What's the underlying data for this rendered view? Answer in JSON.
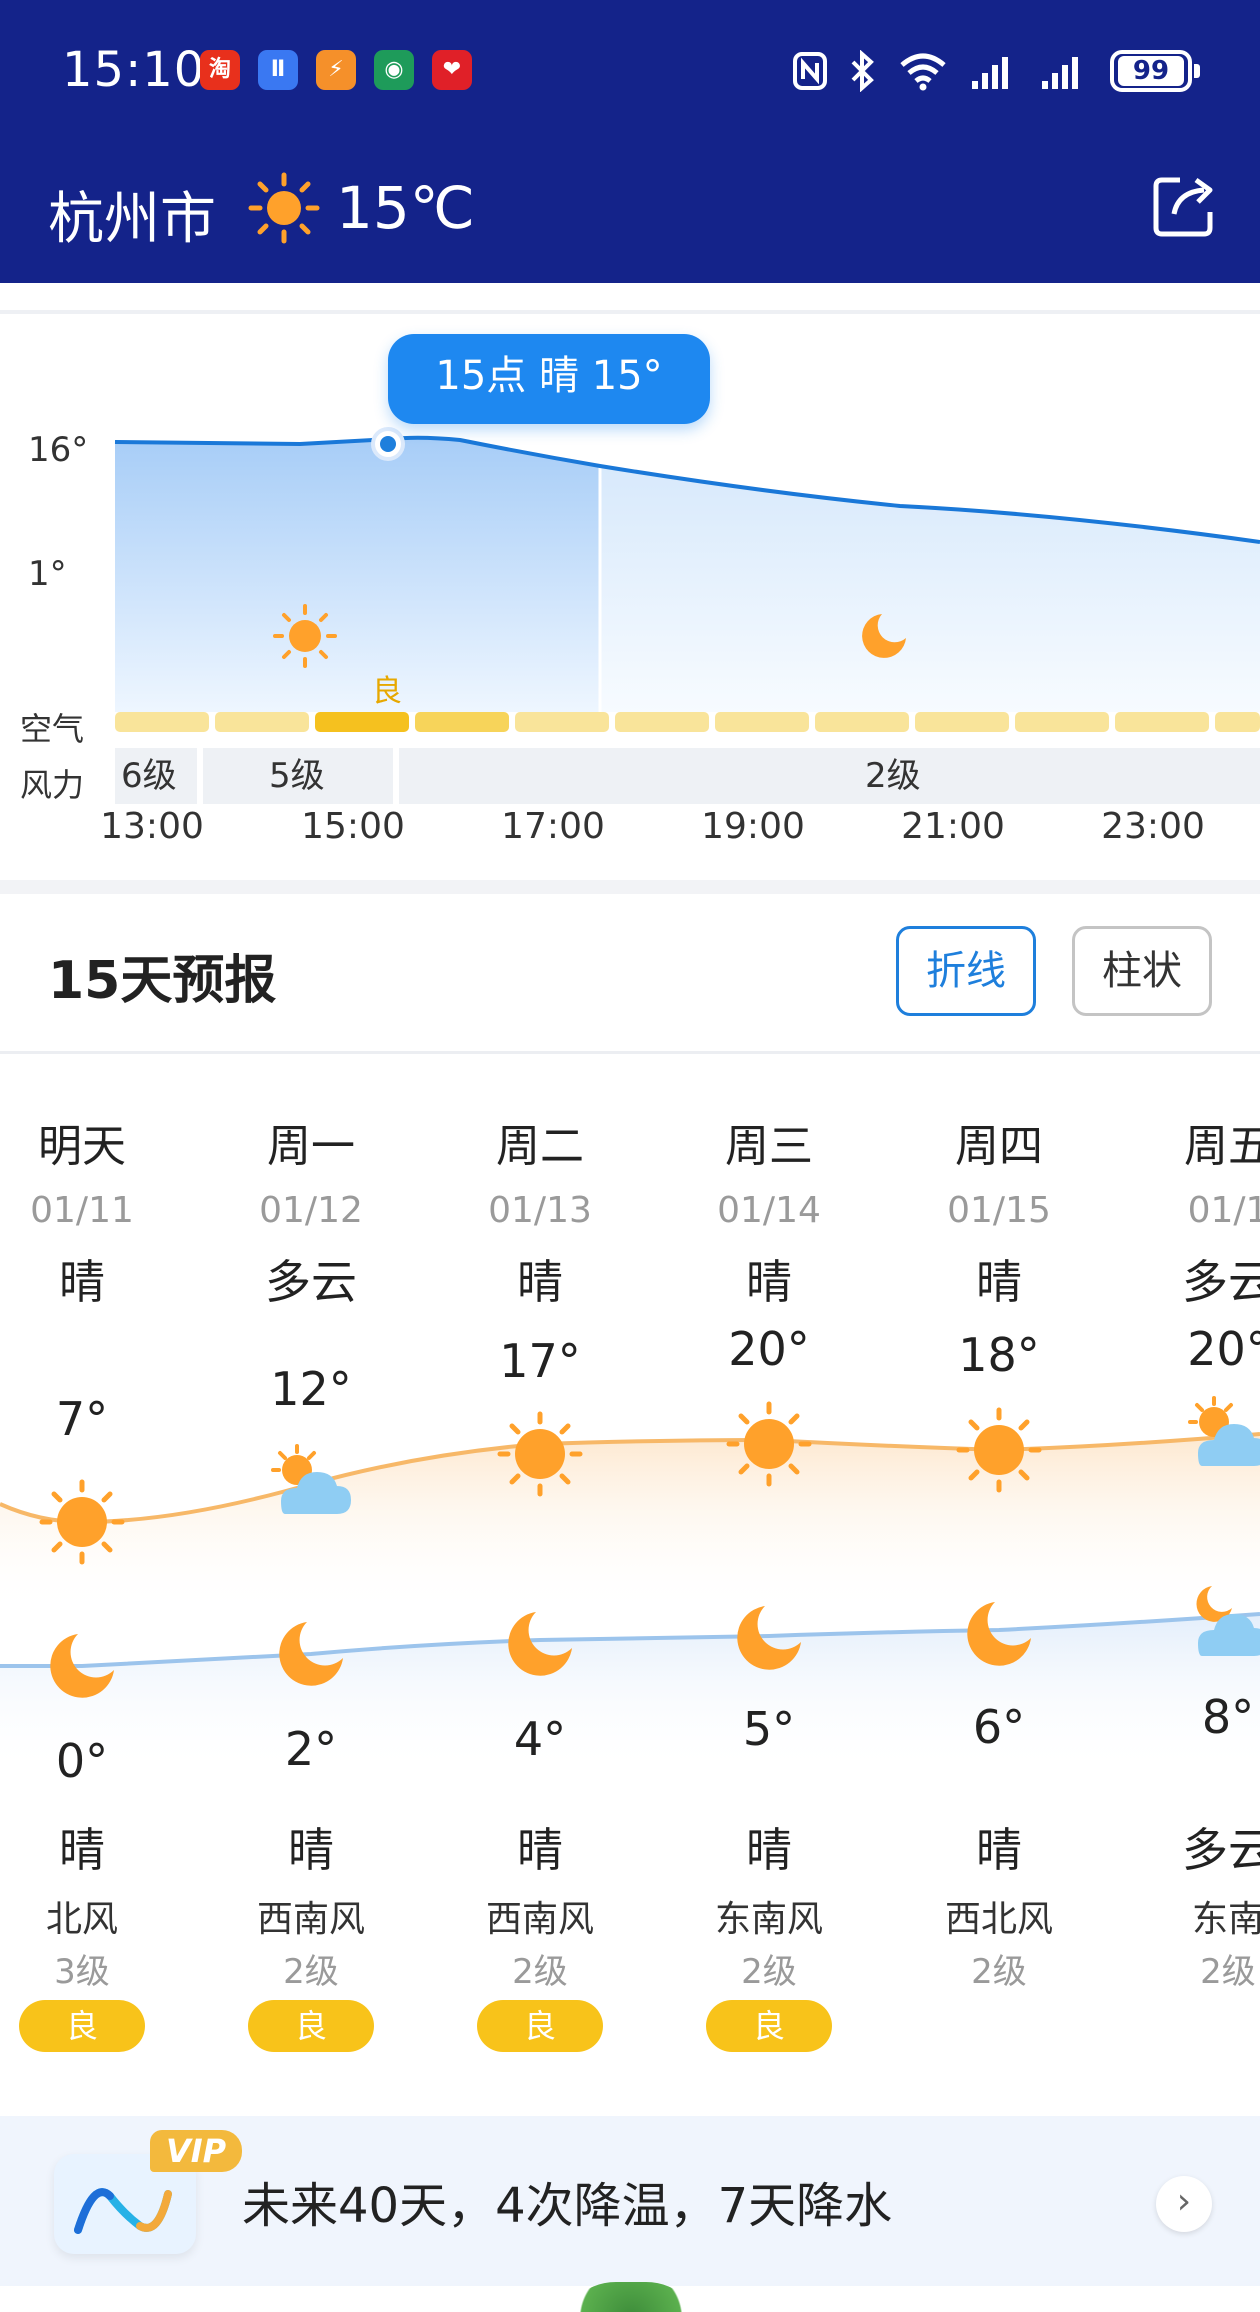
{
  "status_bar": {
    "time": "15:10",
    "app_icons": [
      {
        "name": "taobao-icon",
        "glyph": "淘",
        "color": "#e8301c"
      },
      {
        "name": "app-blue-icon",
        "glyph": "Ⅱ",
        "color": "#3a78f2"
      },
      {
        "name": "app-orange-icon",
        "glyph": "⚡",
        "color": "#f5902a"
      },
      {
        "name": "app-globe-icon",
        "glyph": "◉",
        "color": "#1e9b5a"
      },
      {
        "name": "app-red-icon",
        "glyph": "❤",
        "color": "#e02028"
      }
    ],
    "battery": "99"
  },
  "header": {
    "city": "杭州市",
    "current_temp": "15℃",
    "weather_icon": "sun-icon"
  },
  "hourly": {
    "tooltip": "15点 晴 15°",
    "y_labels": [
      "16°",
      "1°"
    ],
    "air_label": "空气",
    "wind_label": "风力",
    "aq_label": "良",
    "wind_segments": [
      "6级",
      "5级",
      "2级"
    ],
    "hours": [
      "13:00",
      "15:00",
      "17:00",
      "19:00",
      "21:00",
      "23:00"
    ]
  },
  "forecast": {
    "title": "15天预报",
    "btn_line": "折线",
    "btn_bar": "柱状",
    "days": [
      {
        "name": "明天",
        "date": "01/11",
        "day_cond": "晴",
        "high": "7°",
        "low": "0°",
        "night_cond": "晴",
        "wind": "北风",
        "level": "3级",
        "aq": "良",
        "day_icon": "sun-icon",
        "night_icon": "moon-icon"
      },
      {
        "name": "周一",
        "date": "01/12",
        "day_cond": "多云",
        "high": "12°",
        "low": "2°",
        "night_cond": "晴",
        "wind": "西南风",
        "level": "2级",
        "aq": "良",
        "day_icon": "partly-cloudy-icon",
        "night_icon": "moon-icon"
      },
      {
        "name": "周二",
        "date": "01/13",
        "day_cond": "晴",
        "high": "17°",
        "low": "4°",
        "night_cond": "晴",
        "wind": "西南风",
        "level": "2级",
        "aq": "良",
        "day_icon": "sun-icon",
        "night_icon": "moon-icon"
      },
      {
        "name": "周三",
        "date": "01/14",
        "day_cond": "晴",
        "high": "20°",
        "low": "5°",
        "night_cond": "晴",
        "wind": "东南风",
        "level": "2级",
        "aq": "良",
        "day_icon": "sun-icon",
        "night_icon": "moon-icon"
      },
      {
        "name": "周四",
        "date": "01/15",
        "day_cond": "晴",
        "high": "18°",
        "low": "6°",
        "night_cond": "晴",
        "wind": "西北风",
        "level": "2级",
        "aq": "",
        "day_icon": "sun-icon",
        "night_icon": "moon-icon"
      },
      {
        "name": "周五",
        "date": "01/1",
        "day_cond": "多云",
        "high": "20°",
        "low": "8°",
        "night_cond": "多云",
        "wind": "东南",
        "level": "2级",
        "aq": "",
        "day_icon": "partly-cloudy-icon",
        "night_icon": "cloudy-night-icon"
      }
    ]
  },
  "vip": {
    "badge": "VIP",
    "text": "未来40天，4次降温，7天降水",
    "arrow": "›"
  },
  "colors": {
    "header_bg": "#14238a",
    "accent_blue": "#1e88f0",
    "sun_orange": "#ffa12b",
    "aq_yellow": "#f8c31a"
  }
}
